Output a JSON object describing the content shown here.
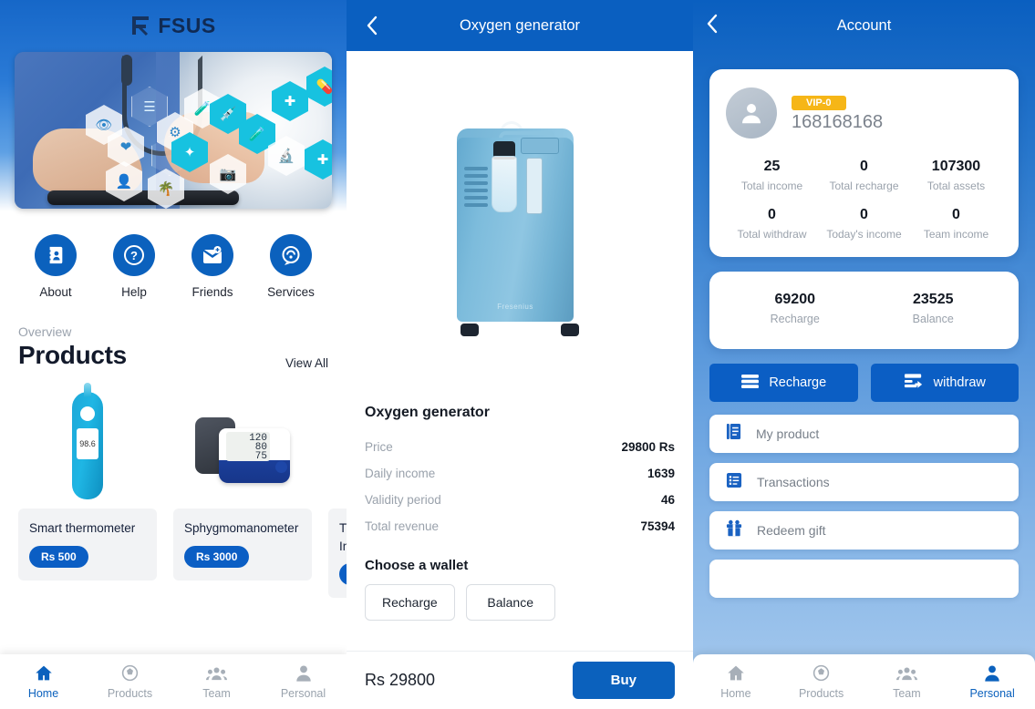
{
  "home": {
    "logo_text": "FSUS",
    "quick_actions": [
      {
        "label": "About",
        "icon": "contact-book-icon"
      },
      {
        "label": "Help",
        "icon": "question-mark-icon"
      },
      {
        "label": "Friends",
        "icon": "add-contact-envelope-icon"
      },
      {
        "label": "Services",
        "icon": "support-chat-icon"
      }
    ],
    "overview_label": "Overview",
    "products_title": "Products",
    "view_all_label": "View All",
    "products": [
      {
        "name": "Smart thermometer",
        "price": "Rs 500",
        "image": "thermometer-image",
        "screen_text": "98.6"
      },
      {
        "name": "Sphygmomanometer",
        "price": "Rs 3000",
        "image": "blood-pressure-monitor-image",
        "screen_text": "120\n80\n75"
      },
      {
        "name": "Th\nIns",
        "price": "R",
        "image": "third-product-image",
        "screen_text": ""
      }
    ],
    "tabs": [
      {
        "label": "Home",
        "icon": "home-icon",
        "active": true
      },
      {
        "label": "Products",
        "icon": "products-icon",
        "active": false
      },
      {
        "label": "Team",
        "icon": "team-icon",
        "active": false
      },
      {
        "label": "Personal",
        "icon": "personal-icon",
        "active": false
      }
    ]
  },
  "detail": {
    "app_bar_title": "Oxygen generator",
    "back_icon": "chevron-left-icon",
    "product_image": "oxygen-concentrator-image",
    "product_brand": "Fresenius",
    "product_name": "Oxygen generator",
    "specs": [
      {
        "key": "Price",
        "value": "29800 Rs"
      },
      {
        "key": "Daily income",
        "value": "1639"
      },
      {
        "key": "Validity period",
        "value": "46"
      },
      {
        "key": "Total revenue",
        "value": "75394"
      }
    ],
    "wallet_title": "Choose a wallet",
    "wallet_options": [
      "Recharge",
      "Balance"
    ],
    "bottom_price": "Rs 29800",
    "buy_label": "Buy"
  },
  "account": {
    "app_bar_title": "Account",
    "back_icon": "chevron-left-icon",
    "vip_badge": "VIP-0",
    "account_id": "168168168",
    "avatar_icon": "user-avatar-icon",
    "stats": [
      {
        "value": "25",
        "label": "Total income"
      },
      {
        "value": "0",
        "label": "Total recharge"
      },
      {
        "value": "107300",
        "label": "Total assets"
      },
      {
        "value": "0",
        "label": "Total withdraw"
      },
      {
        "value": "0",
        "label": "Today's income"
      },
      {
        "value": "0",
        "label": "Team income"
      }
    ],
    "balances": [
      {
        "value": "69200",
        "label": "Recharge"
      },
      {
        "value": "23525",
        "label": "Balance"
      }
    ],
    "actions": [
      {
        "label": "Recharge",
        "icon": "cash-stack-icon"
      },
      {
        "label": "withdraw",
        "icon": "card-withdraw-icon"
      }
    ],
    "menu": [
      {
        "label": "My product",
        "icon": "product-list-icon"
      },
      {
        "label": "Transactions",
        "icon": "transaction-list-icon"
      },
      {
        "label": "Redeem gift",
        "icon": "gift-icon"
      }
    ],
    "tabs": [
      {
        "label": "Home",
        "icon": "home-icon",
        "active": false
      },
      {
        "label": "Products",
        "icon": "products-icon",
        "active": false
      },
      {
        "label": "Team",
        "icon": "team-icon",
        "active": false
      },
      {
        "label": "Personal",
        "icon": "personal-icon",
        "active": true
      }
    ]
  },
  "colors": {
    "primary_blue": "#0b61bd",
    "app_bar_blue": "#0a5fc0",
    "vip_gold": "#f6b617",
    "muted_text": "#9aa2ac",
    "dark_text": "#131a2b"
  }
}
